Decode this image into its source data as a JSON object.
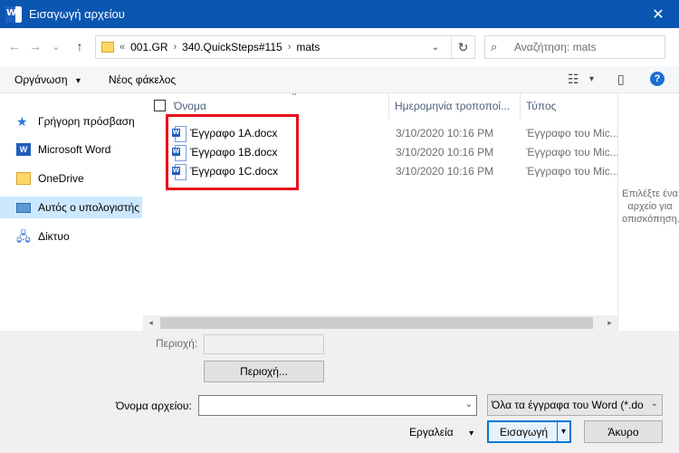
{
  "window": {
    "app_icon_letter": "W",
    "title": "Εισαγωγή αρχείου",
    "close_symbol": "✕"
  },
  "nav": {
    "back": "←",
    "forward": "→",
    "recent": "⌄",
    "up": "↑"
  },
  "address": {
    "overflow": "«",
    "crumbs": [
      "001.GR",
      "340.QuickSteps#115",
      "mats"
    ],
    "separator": "›",
    "dropdown": "⌄",
    "refresh": "↻"
  },
  "search": {
    "icon": "⌕",
    "placeholder": "Αναζήτηση: mats"
  },
  "toolbar": {
    "organize": "Οργάνωση",
    "organize_arrow": "▾",
    "new_folder": "Νέος φάκελος",
    "view_icon": "☷",
    "view_arrow": "▾",
    "pane_icon": "▯",
    "help": "?"
  },
  "sidebar": {
    "items": [
      {
        "label": "Γρήγορη πρόσβαση",
        "icon": "star-icon",
        "glyph": "★"
      },
      {
        "label": "Microsoft Word",
        "icon": "word-icon",
        "glyph": "W"
      },
      {
        "label": "OneDrive",
        "icon": "folder-icon",
        "glyph": ""
      },
      {
        "label": "Αυτός ο υπολογιστής",
        "icon": "computer-icon",
        "glyph": ""
      },
      {
        "label": "Δίκτυο",
        "icon": "network-icon",
        "glyph": "🖧"
      }
    ],
    "selected_index": 3
  },
  "files": {
    "columns": [
      "Όνομα",
      "Ημερομηνία τροποποί...",
      "Τύπος"
    ],
    "sort_indicator": "^",
    "rows": [
      {
        "name": "Έγγραφο 1A.docx",
        "modified": "3/10/2020 10:16 PM",
        "type": "Έγγραφο του Mic..."
      },
      {
        "name": "Έγγραφο 1B.docx",
        "modified": "3/10/2020 10:16 PM",
        "type": "Έγγραφο του Mic..."
      },
      {
        "name": "Έγγραφο 1C.docx",
        "modified": "3/10/2020 10:16 PM",
        "type": "Έγγραφο του Mic..."
      }
    ],
    "scroll_left": "◂",
    "scroll_right": "▸"
  },
  "preview": {
    "text": "Επιλέξτε ένα αρχείο για οπισκόπηση."
  },
  "bottom": {
    "range_label": "Περιοχή:",
    "range_value": "",
    "range_button": "Περιοχή...",
    "filename_label": "Όνομα αρχείου:",
    "filename_value": "",
    "filename_dropdown": "⌄",
    "filetype": "Όλα τα έγγραφα του Word (*.do",
    "filetype_arrow": "⌄",
    "tools": "Εργαλεία",
    "tools_arrow": "▾",
    "insert": "Εισαγωγή",
    "insert_arrow": "▾",
    "cancel": "Άκυρο"
  },
  "colors": {
    "titlebar": "#0a56b0",
    "selection": "#cce8ff",
    "highlight_box": "#e8101b",
    "accent": "#0078d7"
  }
}
